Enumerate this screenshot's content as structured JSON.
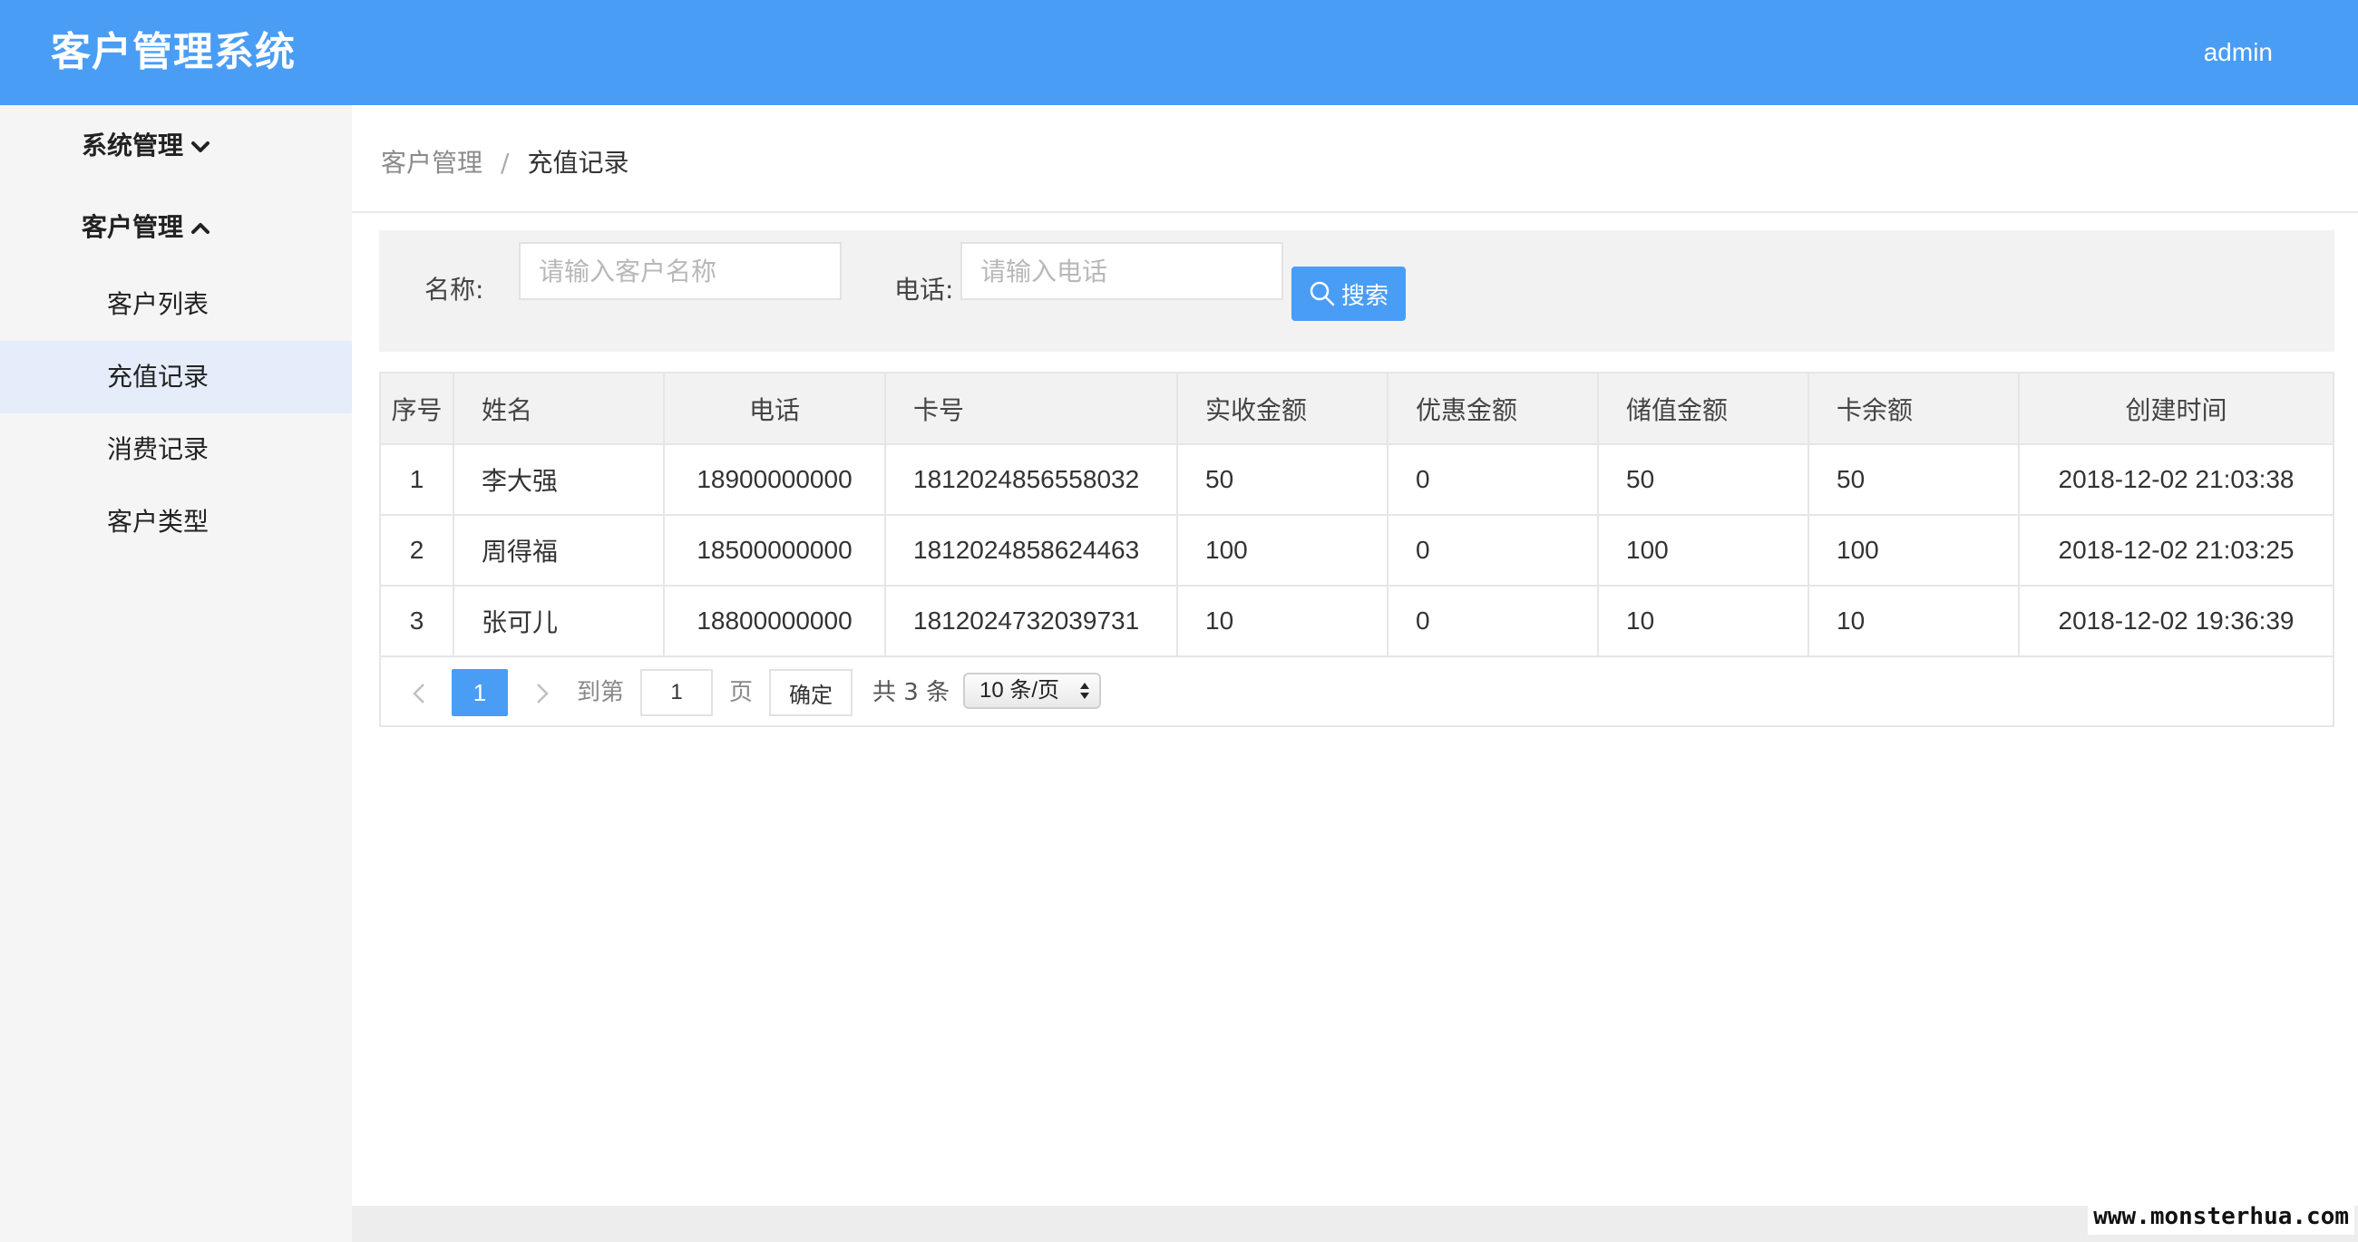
{
  "header": {
    "app_title": "客户管理系统",
    "user": "admin"
  },
  "sidebar": {
    "groups": [
      {
        "label": "系统管理",
        "state": "collapsed",
        "icon": "chevron-down-icon"
      },
      {
        "label": "客户管理",
        "state": "expanded",
        "icon": "chevron-up-icon",
        "items": [
          {
            "label": "客户列表",
            "active": false
          },
          {
            "label": "充值记录",
            "active": true
          },
          {
            "label": "消费记录",
            "active": false
          },
          {
            "label": "客户类型",
            "active": false
          }
        ]
      }
    ]
  },
  "breadcrumb": {
    "parent": "客户管理",
    "separator": "/",
    "current": "充值记录"
  },
  "search": {
    "name_label": "名称:",
    "name_placeholder": "请输入客户名称",
    "phone_label": "电话:",
    "phone_placeholder": "请输入电话",
    "button_label": "搜索",
    "button_icon": "search-icon",
    "accent_color": "#4a9df5"
  },
  "table": {
    "columns": [
      "序号",
      "姓名",
      "电话",
      "卡号",
      "实收金额",
      "优惠金额",
      "储值金额",
      "卡余额",
      "创建时间"
    ],
    "rows": [
      [
        "1",
        "李大强",
        "18900000000",
        "1812024856558032",
        "50",
        "0",
        "50",
        "50",
        "2018-12-02 21:03:38"
      ],
      [
        "2",
        "周得福",
        "18500000000",
        "1812024858624463",
        "100",
        "0",
        "100",
        "100",
        "2018-12-02 21:03:25"
      ],
      [
        "3",
        "张可儿",
        "18800000000",
        "1812024732039731",
        "10",
        "0",
        "10",
        "10",
        "2018-12-02 19:36:39"
      ]
    ]
  },
  "pagination": {
    "current_page": "1",
    "goto_label": "到第",
    "goto_value": "1",
    "page_suffix": "页",
    "confirm_label": "确定",
    "total_text": "共 3 条",
    "page_size": "10 条/页"
  },
  "watermark": "www.monsterhua.com"
}
